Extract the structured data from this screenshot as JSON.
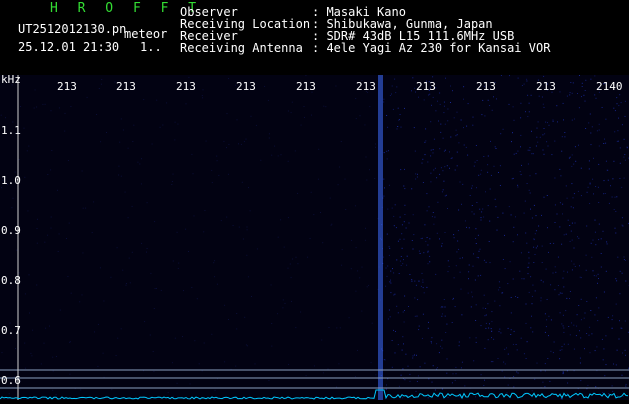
{
  "header": {
    "title": "H R O F F T",
    "filename": "UT2512012130.pn",
    "tag": "meteor",
    "datetime": "25.12.01 21:30",
    "dots": "1..",
    "fields": [
      {
        "label": "Observer",
        "value": ": Masaki Kano"
      },
      {
        "label": "Receiving Location",
        "value": ": Shibukawa, Gunma, Japan"
      },
      {
        "label": "Receiver",
        "value": ": SDR# 43dB L15 111.6MHz USB"
      },
      {
        "label": "Receiving Antenna",
        "value": ": 4ele Yagi Az 230 for Kansai VOR"
      }
    ]
  },
  "spectrogram": {
    "y_unit": "kHz",
    "y_ticks": [
      "1.1",
      "1.0",
      "0.9",
      "0.8",
      "0.7",
      "0.6"
    ],
    "x_ticks": [
      "213",
      "213",
      "213",
      "213",
      "213",
      "213",
      "213",
      "213",
      "213",
      "2140"
    ],
    "colors": {
      "background": "#020212",
      "noise": "#1a2a9a",
      "signal": "#3f6fff",
      "baseline": "#00c8ff",
      "hline": "#8aa0c0"
    }
  }
}
